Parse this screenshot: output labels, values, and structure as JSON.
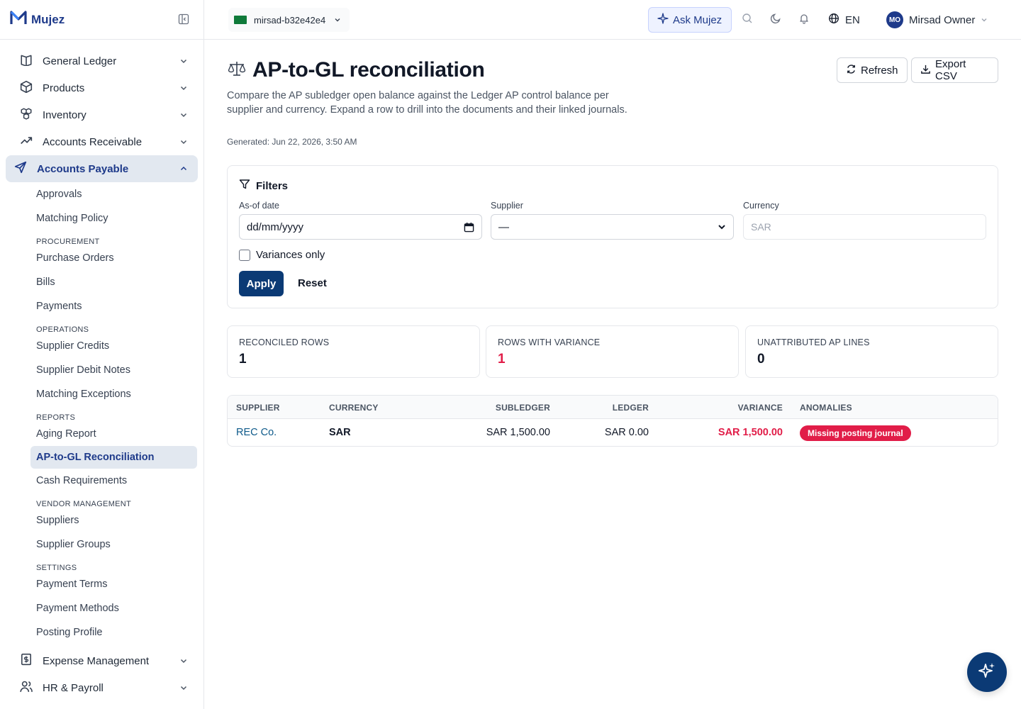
{
  "brand": {
    "name": "Mujez"
  },
  "sidebar": {
    "groups_top": [
      {
        "label": "General Ledger",
        "icon": "book-icon"
      },
      {
        "label": "Products",
        "icon": "box-icon"
      },
      {
        "label": "Inventory",
        "icon": "boxes-icon"
      },
      {
        "label": "Accounts Receivable",
        "icon": "trending-up-icon"
      }
    ],
    "active_group": {
      "label": "Accounts Payable",
      "icon": "send-icon"
    },
    "ap_items": [
      {
        "type": "item",
        "label": "Approvals"
      },
      {
        "type": "item",
        "label": "Matching Policy"
      },
      {
        "type": "section",
        "label": "PROCUREMENT"
      },
      {
        "type": "item",
        "label": "Purchase Orders"
      },
      {
        "type": "item",
        "label": "Bills"
      },
      {
        "type": "item",
        "label": "Payments"
      },
      {
        "type": "section",
        "label": "OPERATIONS"
      },
      {
        "type": "item",
        "label": "Supplier Credits"
      },
      {
        "type": "item",
        "label": "Supplier Debit Notes"
      },
      {
        "type": "item",
        "label": "Matching Exceptions"
      },
      {
        "type": "section",
        "label": "REPORTS"
      },
      {
        "type": "item",
        "label": "Aging Report"
      },
      {
        "type": "item",
        "label": "AP-to-GL Reconciliation",
        "active": true
      },
      {
        "type": "item",
        "label": "Cash Requirements"
      },
      {
        "type": "section",
        "label": "VENDOR MANAGEMENT"
      },
      {
        "type": "item",
        "label": "Suppliers"
      },
      {
        "type": "item",
        "label": "Supplier Groups"
      },
      {
        "type": "section",
        "label": "SETTINGS"
      },
      {
        "type": "item",
        "label": "Payment Terms"
      },
      {
        "type": "item",
        "label": "Payment Methods"
      },
      {
        "type": "item",
        "label": "Posting Profile"
      }
    ],
    "groups_bottom": [
      {
        "label": "Expense Management",
        "icon": "receipt-icon"
      },
      {
        "label": "HR & Payroll",
        "icon": "users-icon"
      }
    ]
  },
  "header": {
    "tenant": "mirsad-b32e42e4",
    "ask_label": "Ask Mujez",
    "language": "EN",
    "user_initials": "MO",
    "user_name": "Mirsad Owner"
  },
  "page": {
    "title": "AP-to-GL reconciliation",
    "description": "Compare the AP subledger open balance against the Ledger AP control balance per supplier and currency. Expand a row to drill into the documents and their linked journals.",
    "generated": "Generated: Jun 22, 2026, 3:50 AM",
    "refresh_label": "Refresh",
    "export_label": "Export CSV"
  },
  "filters": {
    "title": "Filters",
    "asof_label": "As-of date",
    "asof_placeholder": "dd/mm/yyyy",
    "supplier_label": "Supplier",
    "supplier_value": "—",
    "currency_label": "Currency",
    "currency_placeholder": "SAR",
    "variances_only_label": "Variances only",
    "variances_only_checked": false,
    "apply_label": "Apply",
    "reset_label": "Reset"
  },
  "stats": [
    {
      "label": "RECONCILED ROWS",
      "value": "1"
    },
    {
      "label": "ROWS WITH VARIANCE",
      "value": "1"
    },
    {
      "label": "UNATTRIBUTED AP LINES",
      "value": "0"
    }
  ],
  "table": {
    "headers": [
      "SUPPLIER",
      "CURRENCY",
      "SUBLEDGER",
      "LEDGER",
      "VARIANCE",
      "ANOMALIES"
    ],
    "rows": [
      {
        "supplier": "REC Co.",
        "currency": "SAR",
        "subledger": "SAR 1,500.00",
        "ledger": "SAR 0.00",
        "variance": "SAR 1,500.00",
        "anomaly": "Missing posting journal"
      }
    ]
  },
  "colors": {
    "brand": "#1e3a8a",
    "primary": "#0b3a75",
    "danger": "#e11d48",
    "active_bg": "#e2e8f0"
  }
}
